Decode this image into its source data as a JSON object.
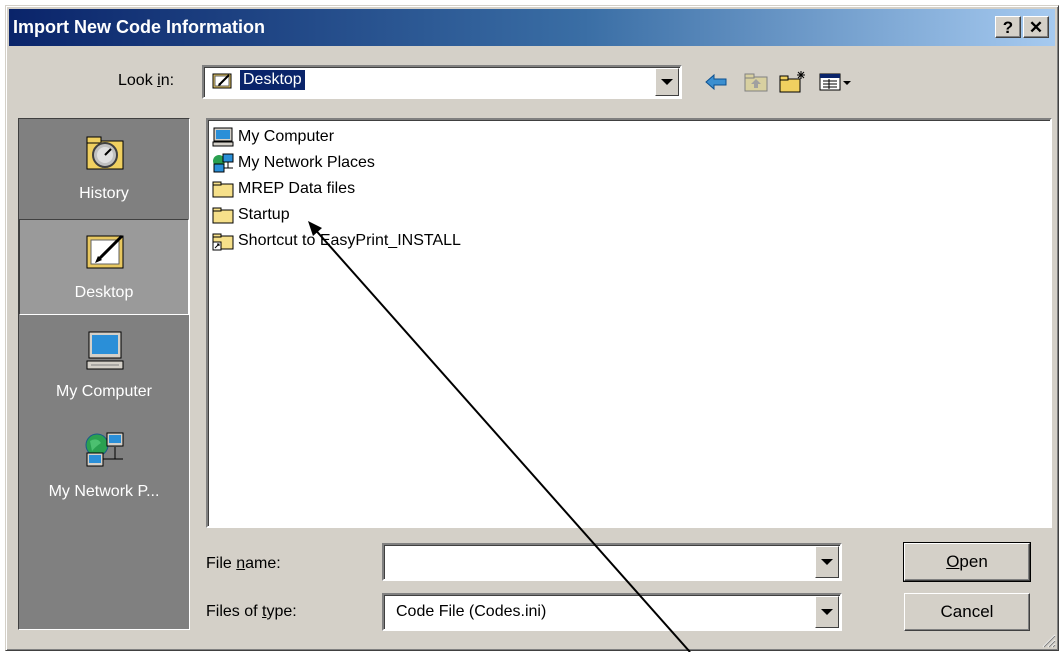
{
  "window": {
    "title": "Import New Code Information",
    "help_glyph": "?",
    "close_glyph": "✕"
  },
  "look_in": {
    "label_pre": "Look ",
    "label_accel": "i",
    "label_post": "n:",
    "value": "Desktop"
  },
  "sidebar": {
    "items": [
      {
        "label": "History",
        "icon": "history-icon"
      },
      {
        "label": "Desktop",
        "icon": "desktop-icon",
        "active": true
      },
      {
        "label": "My Computer",
        "icon": "my-computer-icon"
      },
      {
        "label": "My Network P...",
        "icon": "network-places-icon"
      }
    ]
  },
  "files": [
    {
      "name": "My Computer",
      "icon": "my-computer-icon"
    },
    {
      "name": "My Network Places",
      "icon": "network-places-icon"
    },
    {
      "name": "MREP Data files",
      "icon": "folder-icon"
    },
    {
      "name": "Startup",
      "icon": "folder-icon"
    },
    {
      "name": "Shortcut to EasyPrint_INSTALL",
      "icon": "shortcut-folder-icon"
    }
  ],
  "file_name": {
    "label_pre": "File ",
    "label_accel": "n",
    "label_post": "ame:",
    "value": "",
    "placeholder": ""
  },
  "file_type": {
    "label_pre": "Files of ",
    "label_accel": "t",
    "label_post": "ype:",
    "value": "Code File (Codes.ini)"
  },
  "buttons": {
    "open_accel": "O",
    "open_rest": "pen",
    "cancel": "Cancel"
  },
  "colors": {
    "title_start": "#0a246a",
    "title_end": "#a6caf0",
    "face": "#d4d0c8",
    "selection": "#0a246a"
  }
}
